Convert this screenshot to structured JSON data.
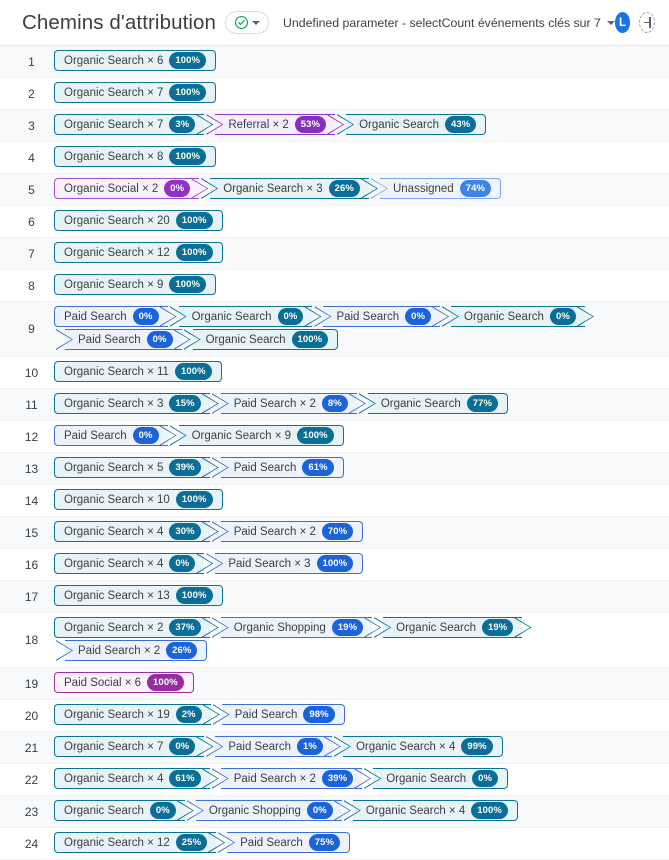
{
  "header": {
    "title": "Chemins d'attribution",
    "status_icon": "check-circle-icon",
    "status_caret": "chevron-down-icon",
    "param_label": "Undefined parameter - selectCount événements clés sur 7",
    "param_caret": "chevron-down-icon",
    "avatar_initial": "L",
    "add_icon": "plus-circle-icon"
  },
  "colors": {
    "organic_search": "#0b7394",
    "paid_search": "#3b6fd4",
    "referral": "#9334c6",
    "organic_social": "#a04fd0",
    "paid_social": "#9c2fa4",
    "unassigned": "#7aa7ea",
    "organic_shopping": "#3f74d6",
    "accent_blue": "#1a73e8",
    "row_odd_bg": "#f8f9fa",
    "row_even_bg": "#ffffff"
  },
  "table": {
    "rows": [
      {
        "index": "1",
        "steps": [
          {
            "label": "Organic Search × 6",
            "value": "100%",
            "channel": "organic-search"
          }
        ]
      },
      {
        "index": "2",
        "steps": [
          {
            "label": "Organic Search × 7",
            "value": "100%",
            "channel": "organic-search"
          }
        ]
      },
      {
        "index": "3",
        "steps": [
          {
            "label": "Organic Search × 7",
            "value": "3%",
            "channel": "organic-search"
          },
          {
            "label": "Referral × 2",
            "value": "53%",
            "channel": "referral"
          },
          {
            "label": "Organic Search",
            "value": "43%",
            "channel": "organic-search"
          }
        ]
      },
      {
        "index": "4",
        "steps": [
          {
            "label": "Organic Search × 8",
            "value": "100%",
            "channel": "organic-search"
          }
        ]
      },
      {
        "index": "5",
        "steps": [
          {
            "label": "Organic Social × 2",
            "value": "0%",
            "channel": "organic-social"
          },
          {
            "label": "Organic Search × 3",
            "value": "26%",
            "channel": "organic-search"
          },
          {
            "label": "Unassigned",
            "value": "74%",
            "channel": "unassigned"
          }
        ]
      },
      {
        "index": "6",
        "steps": [
          {
            "label": "Organic Search × 20",
            "value": "100%",
            "channel": "organic-search"
          }
        ]
      },
      {
        "index": "7",
        "steps": [
          {
            "label": "Organic Search × 12",
            "value": "100%",
            "channel": "organic-search"
          }
        ]
      },
      {
        "index": "8",
        "steps": [
          {
            "label": "Organic Search × 9",
            "value": "100%",
            "channel": "organic-search"
          }
        ]
      },
      {
        "index": "9",
        "steps": [
          {
            "label": "Paid Search",
            "value": "0%",
            "channel": "paid-search"
          },
          {
            "label": "Organic Search",
            "value": "0%",
            "channel": "organic-search"
          },
          {
            "label": "Paid Search",
            "value": "0%",
            "channel": "paid-search"
          },
          {
            "label": "Organic Search",
            "value": "0%",
            "channel": "organic-search"
          },
          {
            "label": "Paid Search",
            "value": "0%",
            "channel": "paid-search"
          },
          {
            "label": "Organic Search",
            "value": "100%",
            "channel": "organic-search"
          }
        ]
      },
      {
        "index": "10",
        "steps": [
          {
            "label": "Organic Search × 11",
            "value": "100%",
            "channel": "organic-search"
          }
        ]
      },
      {
        "index": "11",
        "steps": [
          {
            "label": "Organic Search × 3",
            "value": "15%",
            "channel": "organic-search"
          },
          {
            "label": "Paid Search × 2",
            "value": "8%",
            "channel": "paid-search"
          },
          {
            "label": "Organic Search",
            "value": "77%",
            "channel": "organic-search"
          }
        ]
      },
      {
        "index": "12",
        "steps": [
          {
            "label": "Paid Search",
            "value": "0%",
            "channel": "paid-search"
          },
          {
            "label": "Organic Search × 9",
            "value": "100%",
            "channel": "organic-search"
          }
        ]
      },
      {
        "index": "13",
        "steps": [
          {
            "label": "Organic Search × 5",
            "value": "39%",
            "channel": "organic-search"
          },
          {
            "label": "Paid Search",
            "value": "61%",
            "channel": "paid-search"
          }
        ]
      },
      {
        "index": "14",
        "steps": [
          {
            "label": "Organic Search × 10",
            "value": "100%",
            "channel": "organic-search"
          }
        ]
      },
      {
        "index": "15",
        "steps": [
          {
            "label": "Organic Search × 4",
            "value": "30%",
            "channel": "organic-search"
          },
          {
            "label": "Paid Search × 2",
            "value": "70%",
            "channel": "paid-search"
          }
        ]
      },
      {
        "index": "16",
        "steps": [
          {
            "label": "Organic Search × 4",
            "value": "0%",
            "channel": "organic-search"
          },
          {
            "label": "Paid Search × 3",
            "value": "100%",
            "channel": "paid-search"
          }
        ]
      },
      {
        "index": "17",
        "steps": [
          {
            "label": "Organic Search × 13",
            "value": "100%",
            "channel": "organic-search"
          }
        ]
      },
      {
        "index": "18",
        "steps": [
          {
            "label": "Organic Search × 2",
            "value": "37%",
            "channel": "organic-search"
          },
          {
            "label": "Organic Shopping",
            "value": "19%",
            "channel": "organic-shopping"
          },
          {
            "label": "Organic Search",
            "value": "19%",
            "channel": "organic-search"
          },
          {
            "label": "Paid Search × 2",
            "value": "26%",
            "channel": "paid-search"
          }
        ]
      },
      {
        "index": "19",
        "steps": [
          {
            "label": "Paid Social × 6",
            "value": "100%",
            "channel": "paid-social"
          }
        ]
      },
      {
        "index": "20",
        "steps": [
          {
            "label": "Organic Search × 19",
            "value": "2%",
            "channel": "organic-search"
          },
          {
            "label": "Paid Search",
            "value": "98%",
            "channel": "paid-search"
          }
        ]
      },
      {
        "index": "21",
        "steps": [
          {
            "label": "Organic Search × 7",
            "value": "0%",
            "channel": "organic-search"
          },
          {
            "label": "Paid Search",
            "value": "1%",
            "channel": "paid-search"
          },
          {
            "label": "Organic Search × 4",
            "value": "99%",
            "channel": "organic-search"
          }
        ]
      },
      {
        "index": "22",
        "steps": [
          {
            "label": "Organic Search × 4",
            "value": "61%",
            "channel": "organic-search"
          },
          {
            "label": "Paid Search × 2",
            "value": "39%",
            "channel": "paid-search"
          },
          {
            "label": "Organic Search",
            "value": "0%",
            "channel": "organic-search"
          }
        ]
      },
      {
        "index": "23",
        "steps": [
          {
            "label": "Organic Search",
            "value": "0%",
            "channel": "organic-search"
          },
          {
            "label": "Organic Shopping",
            "value": "0%",
            "channel": "organic-shopping"
          },
          {
            "label": "Organic Search × 4",
            "value": "100%",
            "channel": "organic-search"
          }
        ]
      },
      {
        "index": "24",
        "steps": [
          {
            "label": "Organic Search × 12",
            "value": "25%",
            "channel": "organic-search"
          },
          {
            "label": "Paid Search",
            "value": "75%",
            "channel": "paid-search"
          }
        ]
      }
    ]
  }
}
